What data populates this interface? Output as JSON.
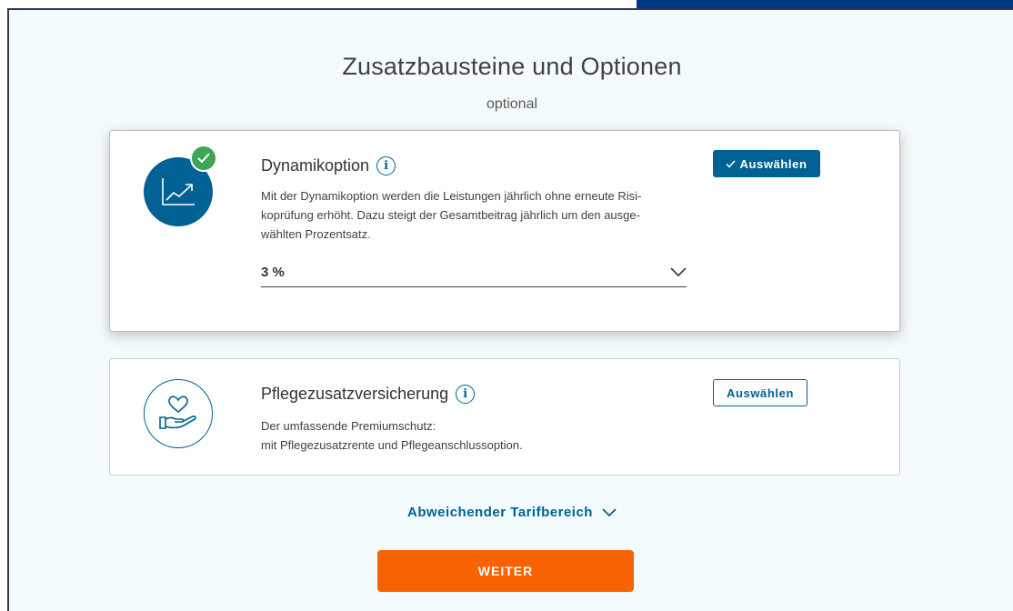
{
  "header": {
    "title": "Zusatzbausteine und Optionen",
    "subtitle": "optional"
  },
  "options": [
    {
      "title": "Dynamikoption",
      "description": "Mit der Dynamikoption werden die Leistungen jährlich ohne erneute Risi-\nkoprüfung erhöht. Dazu steigt der Gesamtbeitrag jährlich um den ausge-\nwählten Prozentsatz.",
      "selected": true,
      "select_label": "Auswählen",
      "dropdown_value": "3 %",
      "icon": "growth-chart-icon"
    },
    {
      "title": "Pflegezusatzversicherung",
      "description": "Der umfassende Premiumschutz:\nmit Pflegezusatzrente und Pflegeanschlussoption.",
      "selected": false,
      "select_label": "Auswählen",
      "icon": "heart-hand-icon"
    }
  ],
  "more_link": "Abweichender Tarifbereich",
  "primary_button": "WEITER",
  "colors": {
    "brand_blue": "#006192",
    "primary_orange": "#f86200",
    "check_green": "#3da556",
    "page_bg": "#f4fbfc"
  }
}
